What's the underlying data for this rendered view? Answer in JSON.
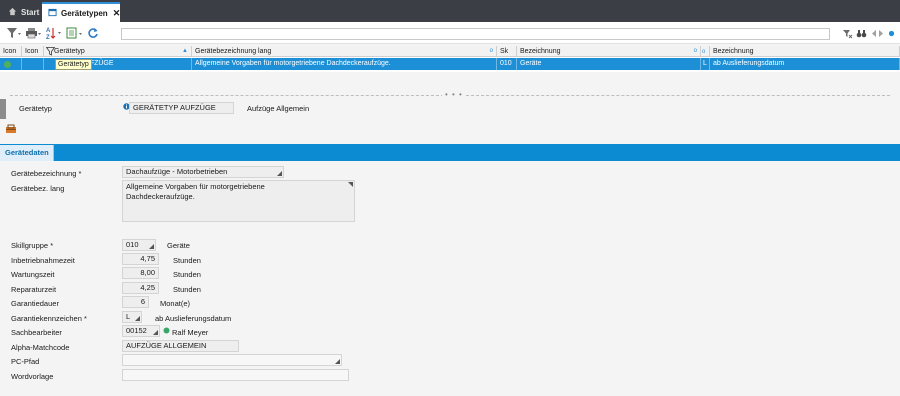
{
  "tabs": {
    "start_label": "Start",
    "active_label": "Gerätetypen",
    "close_glyph": "✕"
  },
  "toolbar": {
    "filter_icon": "filter-icon",
    "print_icon": "print-icon",
    "sort_icon": "sort-az-icon",
    "export_icon": "export-icon",
    "refresh_icon": "refresh-icon",
    "search_value": "",
    "right_icons": [
      "filter-clear-icon",
      "binoculars-icon",
      "nav-prev-icon",
      "nav-next-icon",
      "record-dot-icon"
    ]
  },
  "grid": {
    "headers": [
      "Icon",
      "Icon",
      "Gerätetyp",
      "Gerätebezeichnung lang",
      "Sk",
      "Bezeichnung",
      "G",
      "Bezeichnung"
    ],
    "row": {
      "geraetetyp": "P AUFZÜGE",
      "bezeichnung_lang": "Allgemeine Vorgaben für motorgetriebene Dachdeckeraufzüge.",
      "sk": "010",
      "sk_bezeichnung": "Geräte",
      "g": "L",
      "g_bezeichnung": "ab Auslieferungsdatum"
    },
    "tooltip": "Gerätetyp"
  },
  "splitter_grip": "• • •",
  "info": {
    "label": "Gerätetyp",
    "value": "GERÄTETYP AUFZÜGE",
    "description": "Aufzüge Allgemein"
  },
  "section_tab": "Gerätedaten",
  "form": {
    "geraetebezeichnung": {
      "label": "Gerätebezeichnung *",
      "value": "Dachaufzüge - Motorbetrieben"
    },
    "bez_lang": {
      "label": "Gerätebez. lang",
      "value_line1": "Allgemeine Vorgaben für motorgetriebene",
      "value_line2": "Dachdeckeraufzüge."
    },
    "skillgruppe": {
      "label": "Skillgruppe *",
      "value": "010",
      "text": "Geräte"
    },
    "inbetriebnahmezeit": {
      "label": "Inbetriebnahmezeit",
      "value": "4,75",
      "unit": "Stunden"
    },
    "wartungszeit": {
      "label": "Wartungszeit",
      "value": "8,00",
      "unit": "Stunden"
    },
    "reparaturzeit": {
      "label": "Reparaturzeit",
      "value": "4,25",
      "unit": "Stunden"
    },
    "garantiedauer": {
      "label": "Garantiedauer",
      "value": "6",
      "unit": "Monat(e)"
    },
    "garantiekennzeichen": {
      "label": "Garantiekennzeichen *",
      "value": "L",
      "text": "ab Auslieferungsdatum"
    },
    "sachbearbeiter": {
      "label": "Sachbearbeiter",
      "value": "00152",
      "text": "Ralf Meyer",
      "status_color": "#3aa66a"
    },
    "alpha_matchcode": {
      "label": "Alpha-Matchcode",
      "value": "AUFZÜGE ALLGEMEIN"
    },
    "pc_pfad": {
      "label": "PC-Pfad",
      "value": ""
    },
    "wordvorlage": {
      "label": "Wordvorlage",
      "value": ""
    }
  },
  "colors": {
    "accent": "#0c8bd3",
    "selection": "#1d8fd6",
    "tabbar": "#3b3e44"
  }
}
